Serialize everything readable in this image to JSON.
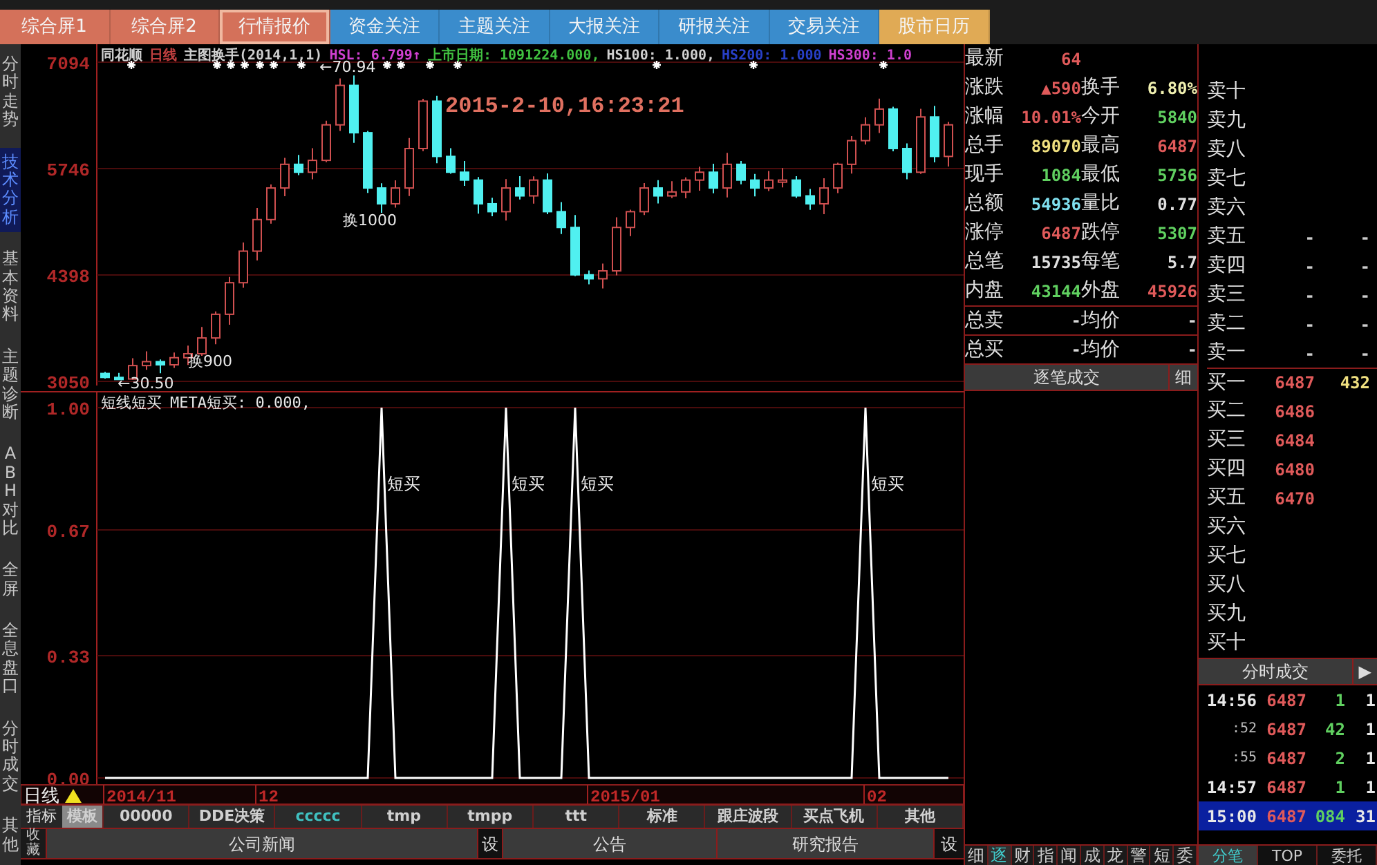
{
  "top_tabs": [
    {
      "label": "综合屏1",
      "color": "#d4715a",
      "selected": false
    },
    {
      "label": "综合屏2",
      "color": "#d4715a",
      "selected": false
    },
    {
      "label": "行情报价",
      "color": "#d4715a",
      "selected": true
    },
    {
      "label": "资金关注",
      "color": "#3a8ccc",
      "selected": false
    },
    {
      "label": "主题关注",
      "color": "#3a8ccc",
      "selected": false
    },
    {
      "label": "大报关注",
      "color": "#3a8ccc",
      "selected": false
    },
    {
      "label": "研报关注",
      "color": "#3a8ccc",
      "selected": false
    },
    {
      "label": "交易关注",
      "color": "#3a8ccc",
      "selected": false
    },
    {
      "label": "股市日历",
      "color": "#e0aa55",
      "selected": false
    }
  ],
  "sidebar": {
    "items": [
      {
        "label": "分时走势",
        "selected": false
      },
      {
        "label": "技术分析",
        "selected": true
      },
      {
        "label": "基本资料",
        "selected": false
      },
      {
        "label": "主题诊断",
        "selected": false
      },
      {
        "label": "ABH对比",
        "selected": false
      },
      {
        "label": "全屏",
        "selected": false
      },
      {
        "label": "全息盘口",
        "selected": false
      },
      {
        "label": "分时成交",
        "selected": false
      },
      {
        "label": "其他",
        "selected": false
      }
    ]
  },
  "price_chart": {
    "header": [
      {
        "text": "同花顺",
        "color": "#d0d0d0"
      },
      {
        "text": "日线",
        "color": "#c04040"
      },
      {
        "text": "主图换手(2014,1,1)",
        "color": "#d0d0d0"
      },
      {
        "text": "HSL: 6.799↑",
        "color": "#d040d0"
      },
      {
        "text": "上市日期: 1091224.000,",
        "color": "#40c040"
      },
      {
        "text": "HS100: 1.000,",
        "color": "#d0d0d0"
      },
      {
        "text": "HS200: 1.000",
        "color": "#2840c8"
      },
      {
        "text": "HS300: 1.0",
        "color": "#d040d0"
      }
    ],
    "y_labels": [
      "7094",
      "5746",
      "4398",
      "3050"
    ],
    "timestamp": "2015-2-10,16:23:21",
    "notes": [
      "←70.94",
      "换1000",
      "换900",
      "←30.50"
    ]
  },
  "indicator": {
    "legend": "META短买: 0.000,",
    "period_label": "日线",
    "date_labels": [
      "2014/11",
      "12",
      "2015/01",
      "02"
    ],
    "chart_data": {
      "type": "line",
      "title": "短线短买",
      "ylim": [
        0,
        1
      ],
      "yticks": [
        {
          "value": 1,
          "label": "1.00"
        },
        {
          "value": 0.67,
          "label": "0.67"
        },
        {
          "value": 0.33,
          "label": "0.33"
        },
        {
          "value": 0,
          "label": "0.00"
        }
      ],
      "series": [
        {
          "color": "#ffffff",
          "values": [
            0,
            0,
            0,
            0,
            0,
            0,
            0,
            0,
            0,
            0,
            0,
            0,
            0,
            0,
            0,
            0,
            0,
            0,
            0,
            0,
            1,
            0,
            0,
            0,
            0,
            0,
            0,
            0,
            0,
            1,
            0,
            0,
            0,
            0,
            1,
            0,
            0,
            0,
            0,
            0,
            0,
            0,
            0,
            0,
            0,
            0,
            0,
            0,
            0,
            0,
            0,
            0,
            0,
            0,
            0,
            1,
            0,
            0,
            0,
            0,
            0,
            0
          ]
        }
      ],
      "annotations": [
        "短买",
        "短买",
        "短买",
        "短买"
      ]
    }
  },
  "indicator_tabs": {
    "label": "指标",
    "tabs": [
      {
        "label": "模板",
        "selected": true,
        "kind": "system"
      },
      {
        "label": "00000",
        "selected": false,
        "kind": "system"
      },
      {
        "label": "DDE决策",
        "selected": false,
        "kind": "system"
      },
      {
        "label": "ccccc",
        "selected": false,
        "kind": "user"
      },
      {
        "label": "tmp",
        "selected": false,
        "kind": "system"
      },
      {
        "label": "tmpp",
        "selected": false,
        "kind": "system"
      },
      {
        "label": "ttt",
        "selected": false,
        "kind": "system"
      },
      {
        "label": "标准",
        "selected": false,
        "kind": "system"
      },
      {
        "label": "跟庄波段",
        "selected": false,
        "kind": "system"
      },
      {
        "label": "买点飞机",
        "selected": false,
        "kind": "system"
      },
      {
        "label": "其他",
        "selected": false,
        "kind": "system"
      }
    ]
  },
  "news_bar": {
    "side_label": "收藏",
    "items": [
      {
        "label": "公司新闻",
        "kind": "tab"
      },
      {
        "label": "设",
        "kind": "settings"
      },
      {
        "label": "公告",
        "kind": "tab"
      },
      {
        "label": "研究报告",
        "kind": "tab"
      },
      {
        "label": "设",
        "kind": "settings"
      }
    ]
  },
  "quote": {
    "rows": [
      {
        "cells": [
          {
            "label": "最新",
            "value": "64",
            "color": "#e05a5a"
          }
        ]
      },
      {
        "cells": [
          {
            "label": "涨跌",
            "value": "▲590",
            "color": "#e05a5a"
          },
          {
            "label": "换手",
            "value": "6.80%",
            "color": "#f0f0b0"
          }
        ]
      },
      {
        "cells": [
          {
            "label": "涨幅",
            "value": "10.01%",
            "color": "#e05a5a"
          },
          {
            "label": "今开",
            "value": "5840",
            "color": "#60d060"
          }
        ]
      },
      {
        "cells": [
          {
            "label": "总手",
            "value": "89070",
            "color": "#f0e080"
          },
          {
            "label": "最高",
            "value": "6487",
            "color": "#e05a5a"
          }
        ]
      },
      {
        "cells": [
          {
            "label": "现手",
            "value": "1084",
            "color": "#60d060"
          },
          {
            "label": "最低",
            "value": "5736",
            "color": "#60d060"
          }
        ]
      },
      {
        "cells": [
          {
            "label": "总额",
            "value": "54936",
            "color": "#80e0f0"
          },
          {
            "label": "量比",
            "value": "0.77",
            "color": "#e0e0e0"
          }
        ]
      },
      {
        "cells": [
          {
            "label": "涨停",
            "value": "6487",
            "color": "#e05a5a"
          },
          {
            "label": "跌停",
            "value": "5307",
            "color": "#60d060"
          }
        ]
      },
      {
        "cells": [
          {
            "label": "总笔",
            "value": "15735",
            "color": "#e0e0e0"
          },
          {
            "label": "每笔",
            "value": "5.7",
            "color": "#e0e0e0"
          }
        ]
      },
      {
        "cells": [
          {
            "label": "内盘",
            "value": "43144",
            "color": "#60d060"
          },
          {
            "label": "外盘",
            "value": "45926",
            "color": "#e05a5a"
          }
        ]
      }
    ],
    "totals": [
      {
        "cells": [
          {
            "label": "总卖",
            "value": "-"
          },
          {
            "label": "均价",
            "value": "-"
          }
        ]
      },
      {
        "cells": [
          {
            "label": "总买",
            "value": "-"
          },
          {
            "label": "均价",
            "value": "-"
          }
        ]
      }
    ],
    "trades_header": {
      "title": "逐笔成交",
      "button": "细"
    },
    "bottom_tabs": [
      {
        "label": "细",
        "selected": false
      },
      {
        "label": "逐",
        "selected": true
      },
      {
        "label": "财",
        "selected": false
      },
      {
        "label": "指",
        "selected": false
      },
      {
        "label": "闻",
        "selected": false
      },
      {
        "label": "成",
        "selected": false
      },
      {
        "label": "龙",
        "selected": false
      },
      {
        "label": "警",
        "selected": false
      },
      {
        "label": "短",
        "selected": false
      },
      {
        "label": "委",
        "selected": false
      }
    ]
  },
  "order_book": {
    "asks": [
      {
        "label": "卖十"
      },
      {
        "label": "卖九"
      },
      {
        "label": "卖八"
      },
      {
        "label": "卖七"
      },
      {
        "label": "卖六"
      },
      {
        "label": "卖五",
        "price": "-",
        "volume": "-"
      },
      {
        "label": "卖四",
        "price": "-",
        "volume": "-"
      },
      {
        "label": "卖三",
        "price": "-",
        "volume": "-"
      },
      {
        "label": "卖二",
        "price": "-",
        "volume": "-"
      },
      {
        "label": "卖一",
        "price": "-",
        "volume": "-"
      }
    ],
    "bids": [
      {
        "label": "买一",
        "price": "6487",
        "volume": "432"
      },
      {
        "label": "买二",
        "price": "6486"
      },
      {
        "label": "买三",
        "price": "6484"
      },
      {
        "label": "买四",
        "price": "6480"
      },
      {
        "label": "买五",
        "price": "6470"
      },
      {
        "label": "买六"
      },
      {
        "label": "买七"
      },
      {
        "label": "买八"
      },
      {
        "label": "买九"
      },
      {
        "label": "买十"
      }
    ],
    "ticks_header": {
      "title": "分时成交",
      "button": "▶"
    },
    "ticks": [
      {
        "time": "14:56",
        "price": "6487",
        "volume": "1",
        "count": "1",
        "selected": false
      },
      {
        "time": ":52",
        "price": "6487",
        "volume": "42",
        "count": "1",
        "selected": false
      },
      {
        "time": ":55",
        "price": "6487",
        "volume": "2",
        "count": "1",
        "selected": false
      },
      {
        "time": "14:57",
        "price": "6487",
        "volume": "1",
        "count": "1",
        "selected": false
      },
      {
        "time": "15:00",
        "price": "6487",
        "volume": "084",
        "count": "31",
        "selected": true
      }
    ],
    "bottom_tabs": [
      {
        "label": "分笔",
        "selected": true
      },
      {
        "label": "TOP",
        "selected": false
      },
      {
        "label": "委托",
        "selected": false
      }
    ]
  }
}
